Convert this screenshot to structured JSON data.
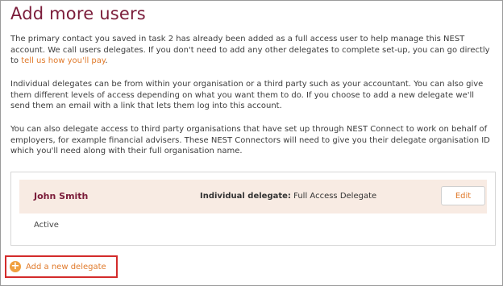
{
  "page": {
    "title": "Add more users"
  },
  "intro": {
    "p1_text": "The primary contact you saved in task 2 has already been added as a full access user to help manage this NEST account. We call users delegates. If you don't need to add any other delegates to complete set-up, you can go directly to ",
    "p1_link": "tell us how you'll pay",
    "p1_end": ".",
    "p2": "Individual delegates can be from within your organisation or a third party such as your accountant. You can also give them different levels of access depending on what you want them to do. If you choose to add a new delegate we'll send them an email with a link that lets them log into this account.",
    "p3": "You can also delegate access to third party organisations that have set up through NEST Connect to work on behalf of employers, for example financial advisers. These NEST Connectors will need to give you their delegate organisation ID which you'll need along with their full organisation name."
  },
  "delegates": [
    {
      "name": "John Smith",
      "type_label": "Individual delegate:",
      "type_value": "Full Access Delegate",
      "edit_label": "Edit",
      "status": "Active"
    }
  ],
  "actions": {
    "add_delegate_label": "Add a new delegate",
    "add_icon": "plus-circle-icon"
  },
  "colors": {
    "title": "#7b1c3a",
    "link": "#e07a2b",
    "row_bg": "#f8ebe3",
    "highlight_border": "#d32b2b",
    "add_icon_bg": "#f0a040"
  }
}
